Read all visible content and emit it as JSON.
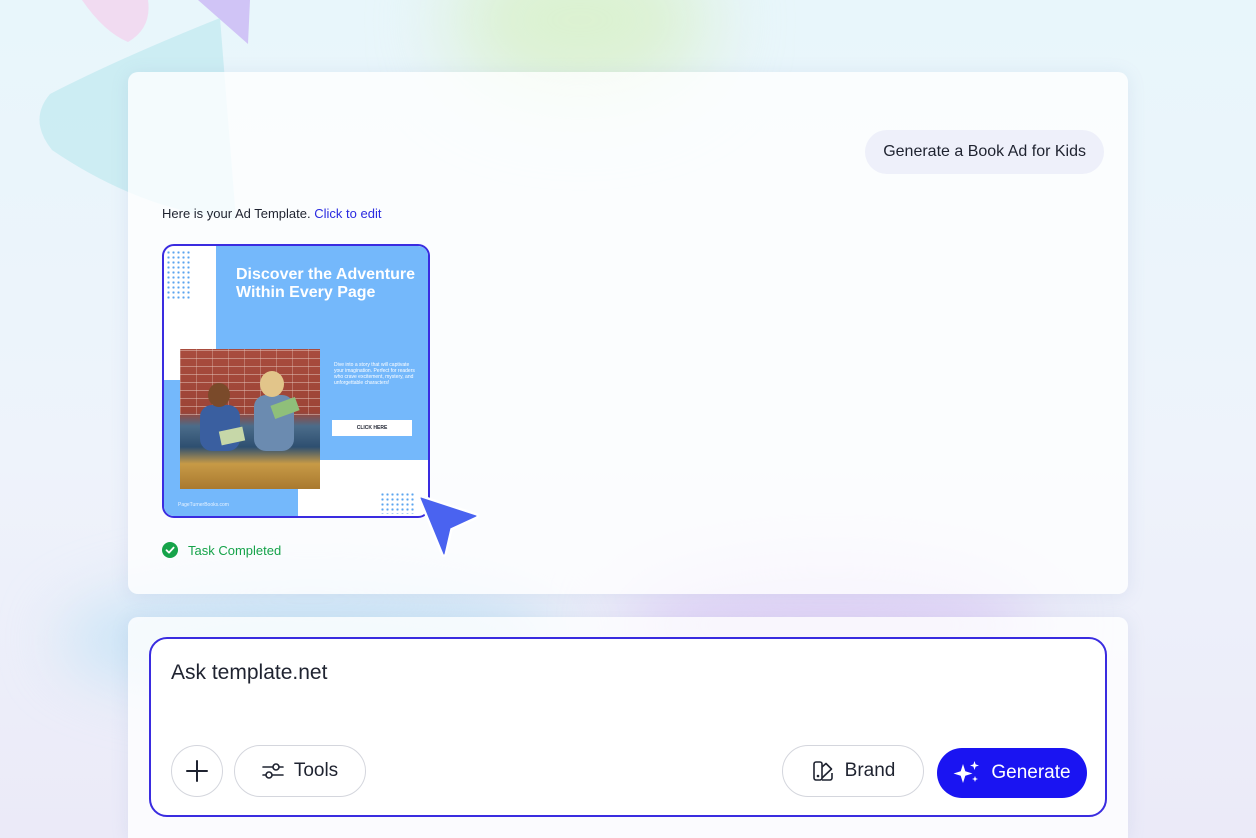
{
  "chat": {
    "user_message": "Generate a Book Ad for Kids",
    "ai_message_prefix": "Here is your Ad Template.",
    "ai_message_link": "Click to edit",
    "status": "Task Completed"
  },
  "ad_template": {
    "headline": "Discover the Adventure Within Every Page",
    "body": "Dive into a story that will captivate your imagination. Perfect for readers who crave excitement, mystery, and unforgettable characters!",
    "cta": "CLICK HERE",
    "footer": "PageTurnerBooks.com"
  },
  "composer": {
    "placeholder": "Ask template.net",
    "tools_label": "Tools",
    "brand_label": "Brand",
    "generate_label": "Generate"
  },
  "icons": {
    "add": "plus-icon",
    "tools": "sliders-icon",
    "brand": "palette-icon",
    "generate": "sparkles-icon",
    "status": "check-circle-icon",
    "cursor": "cursor-arrow-icon"
  },
  "colors": {
    "accent": "#1a14f2",
    "border_accent": "#3a2ce0",
    "link": "#2a2ae0",
    "success": "#16a34a",
    "ad_blue": "#74b8fb"
  }
}
